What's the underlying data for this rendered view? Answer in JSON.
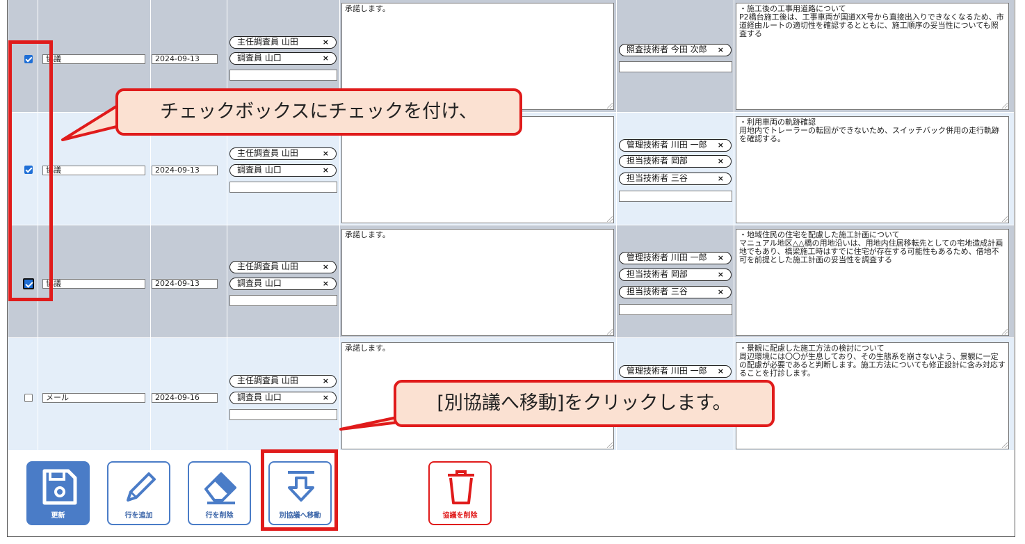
{
  "rows": [
    {
      "checked": true,
      "type": "協議",
      "date": "2024-09-13",
      "investigators": [
        {
          "label": "主任調査員 山田",
          "remove": "×"
        },
        {
          "label": "調査員 山口",
          "remove": "×"
        }
      ],
      "response": "承諾します。",
      "engineers": [
        {
          "label": "照査技術者 今田 次郎",
          "remove": "×"
        }
      ],
      "note_title": "・施工後の工事用道路について",
      "note_body": "P2橋台施工後は、工事車両が国道XX号から直接出入りできなくなるため、市道経由ルートの適切性を確認するとともに、施工順序の妥当性についても照査する"
    },
    {
      "checked": true,
      "type": "協議",
      "date": "2024-09-13",
      "investigators": [
        {
          "label": "主任調査員 山田",
          "remove": "×"
        },
        {
          "label": "調査員 山口",
          "remove": "×"
        }
      ],
      "response": "",
      "engineers": [
        {
          "label": "管理技術者 川田 一郎",
          "remove": "×"
        },
        {
          "label": "担当技術者 岡部",
          "remove": "×"
        },
        {
          "label": "担当技術者 三谷",
          "remove": "×"
        }
      ],
      "note_title": "・利用車両の軌跡確認",
      "note_body": "用地内でトレーラーの転回ができないため、スイッチバック併用の走行軌跡を確認する。"
    },
    {
      "checked": true,
      "type": "協議",
      "date": "2024-09-13",
      "investigators": [
        {
          "label": "主任調査員 山田",
          "remove": "×"
        },
        {
          "label": "調査員 山口",
          "remove": "×"
        }
      ],
      "response": "承諾します。",
      "engineers": [
        {
          "label": "管理技術者 川田 一郎",
          "remove": "×"
        },
        {
          "label": "担当技術者 岡部",
          "remove": "×"
        },
        {
          "label": "担当技術者 三谷",
          "remove": "×"
        }
      ],
      "note_title": "・地域住民の住宅を配慮した施工計画について",
      "note_body": "マニュアル地区△△橋の用地沿いは、用地内住居移転先としての宅地造成計画地でもあり、橋梁施工時はすでに住宅が存在する可能性もあるため、借地不可を前提とした施工計画の妥当性を調査する"
    },
    {
      "checked": false,
      "type": "メール",
      "date": "2024-09-16",
      "investigators": [
        {
          "label": "主任調査員 山田",
          "remove": "×"
        },
        {
          "label": "調査員 山口",
          "remove": "×"
        }
      ],
      "response": "承諾します。",
      "engineers": [
        {
          "label": "管理技術者 川田 一郎",
          "remove": "×"
        }
      ],
      "note_title": "・景観に配慮した施工方法の検討について",
      "note_body": "周辺環境には〇〇が生息しており、その生態系を崩さないよう、景観に一定の配慮が必要であると判断します。施工方法についても修正設計に含み対応することを打診します。"
    }
  ],
  "toolbar": {
    "update": "更新",
    "add_row": "行を追加",
    "delete_row": "行を削除",
    "move": "別協議へ移動",
    "delete_consult": "協議を削除"
  },
  "callouts": {
    "check": "チェックボックスにチェックを付け、",
    "click": "[別協議へ移動]をクリックします。"
  },
  "colors": {
    "accent": "#4a7cc7",
    "danger": "#e01b1b",
    "callout_fill": "#fbe1d2",
    "row_dark": "#c4cbd6",
    "row_light": "#e4eef9"
  }
}
